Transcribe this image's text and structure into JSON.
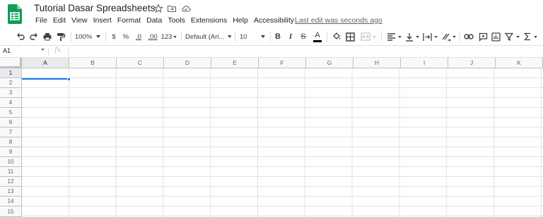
{
  "app": {
    "doc_title": "Tutorial Dasar Spreadsheets",
    "last_edit": "Last edit was seconds ago",
    "brand_color": "#0f9d58",
    "accent_color": "#1a73e8"
  },
  "menu": [
    "File",
    "Edit",
    "View",
    "Insert",
    "Format",
    "Data",
    "Tools",
    "Extensions",
    "Help",
    "Accessibility"
  ],
  "toolbar": {
    "zoom": "100%",
    "currency": "$",
    "percent": "%",
    "decrease_decimal": ".0",
    "increase_decimal": ".00",
    "more_formats": "123",
    "font": "Default (Ari...",
    "font_size": "10",
    "bold": "B",
    "italic": "I",
    "strike": "S",
    "text_color": "A"
  },
  "formula_bar": {
    "name_box": "A1",
    "fx": "fx",
    "value": ""
  },
  "grid": {
    "columns": [
      "A",
      "B",
      "C",
      "D",
      "E",
      "F",
      "G",
      "H",
      "I",
      "J",
      "K"
    ],
    "rows": [
      "1",
      "2",
      "3",
      "4",
      "5",
      "6",
      "7",
      "8",
      "9",
      "10",
      "11",
      "12",
      "13",
      "14",
      "15"
    ],
    "selected_cell": "A1"
  }
}
